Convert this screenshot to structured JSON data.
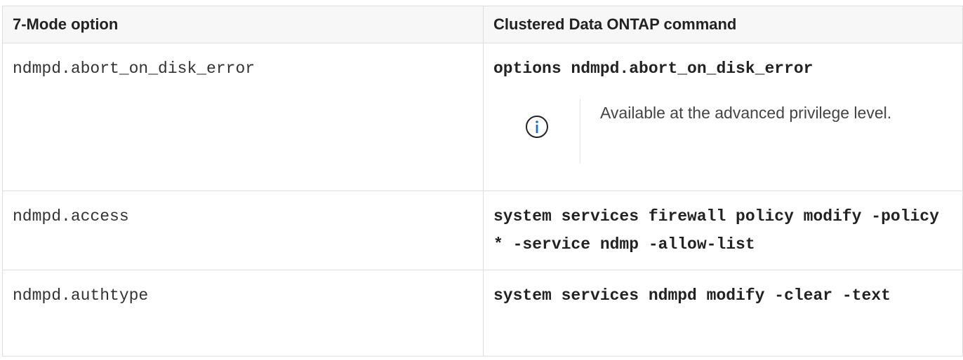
{
  "table": {
    "headers": [
      "7-Mode option",
      "Clustered Data ONTAP command"
    ],
    "rows": [
      {
        "option": "ndmpd.abort_on_disk_error",
        "command": "options ndmpd.abort_on_disk_error",
        "note": "Available at the advanced privilege level.",
        "note_icon": "info-icon"
      },
      {
        "option": "ndmpd.access",
        "command": "system services firewall policy modify -policy * -service ndmp -allow-list"
      },
      {
        "option": "ndmpd.authtype",
        "command": "system services ndmpd modify -clear -text"
      }
    ]
  },
  "colors": {
    "header_bg": "#f7f7f7",
    "border": "#dedede",
    "info_icon": "#1a73c8"
  }
}
